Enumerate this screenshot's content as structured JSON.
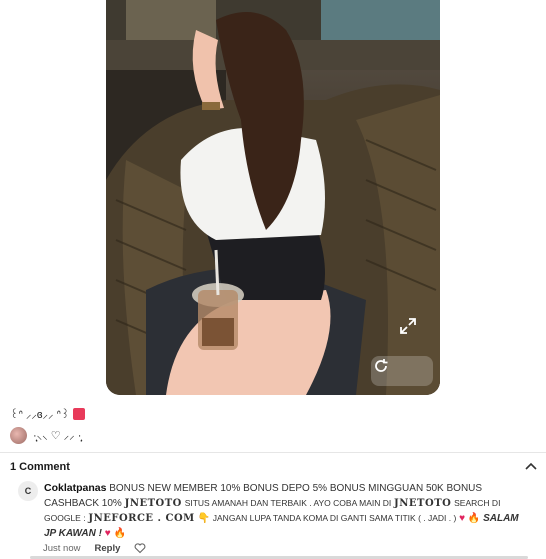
{
  "post": {
    "caption_text": "꒰ᐢ ⸝⸝ɞ⸝⸝ ᐢ꒱",
    "user_caption": "·̩͙⸜⸜ ♡ ⸝⸝ ·̩͙",
    "expand_icon": "expand-icon",
    "rotate_icon": "rotate-icon"
  },
  "comments": {
    "title": "1 Comment",
    "collapse_icon": "chevron-up-icon",
    "items": [
      {
        "avatar_letter": "C",
        "author": "Coklatpanas",
        "text_1": "BONUS NEW MEMBER 10% BONUS DEPO 5% BONUS MINGGUAN 50K BONUS CASHBACK 10%",
        "brand_1": "JNETOTO",
        "text_2": "SITUS AMANAH DAN TERBAIK . AYO COBA MAIN DI",
        "brand_2": "JNETOTO",
        "text_3": "SEARCH DI GOOGLE :",
        "domain": "JNEFORCE . COM",
        "text_4": "JANGAN LUPA TANDA KOMA DI GANTI SAMA TITIK ( . JADI . )",
        "closing": "SALAM JP KAWAN !",
        "time": "Just now",
        "reply_label": "Reply",
        "like_icon": "heart-outline-icon"
      }
    ]
  },
  "colors": {
    "heart": "#e0245e",
    "accent_red": "#e83a5a"
  }
}
